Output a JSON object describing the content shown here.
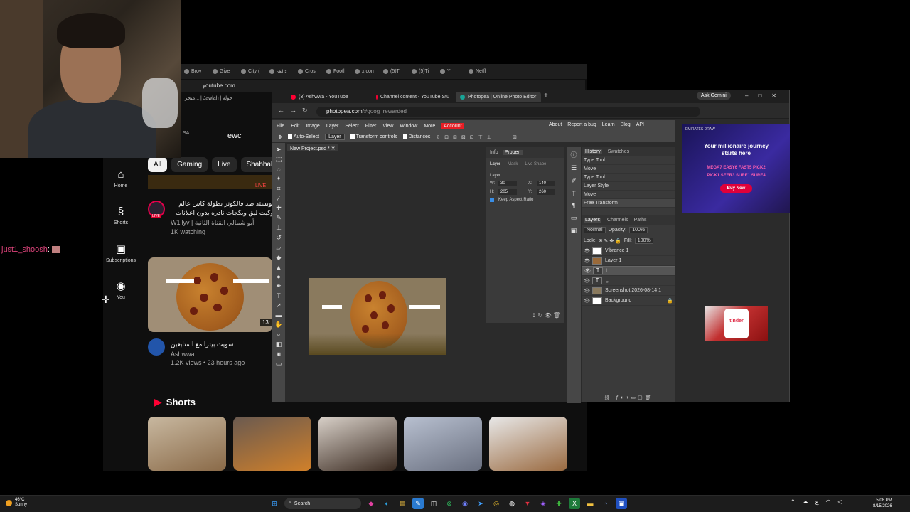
{
  "overlay": {
    "chat_user": "just1_shoosh",
    "chat_sep": ":"
  },
  "youtube": {
    "tabs": [
      "Brov",
      "Give",
      "City (",
      "شاهد",
      "Cros",
      "Footl",
      "x.con",
      "(5)Ti",
      "(5)Ti",
      "Y",
      "Netfl"
    ],
    "address": "youtube.com",
    "bookmarks": "متجر... | Jawlah | جولة",
    "search_value": "ewc",
    "sa_label": "SA",
    "nav": [
      {
        "icon": "home-icon",
        "label": "Home"
      },
      {
        "icon": "shorts-icon",
        "label": "Shorts"
      },
      {
        "icon": "subscriptions-icon",
        "label": "Subscriptions"
      },
      {
        "icon": "you-icon",
        "label": "You"
      }
    ],
    "chips": [
      "All",
      "Gaming",
      "Live",
      "Shabbal"
    ],
    "live_video": {
      "title": "تويستد ضد فالكونز بطولة كاس عالم وكيت ليق وبكجات نادره بدون اعلانات",
      "badge": "LIVE",
      "channel": "W1llyv | أبو شمالي القناة الثانية",
      "watching": "1K watching"
    },
    "video": {
      "title": "سويت بيتزا مع المتابعين",
      "duration": "13:",
      "channel": "Ashwwa",
      "meta": "1.2K views • 23 hours ago"
    },
    "shorts_title": "Shorts"
  },
  "photopea": {
    "tabs": [
      "(3) Ashwwa - YouTube",
      "Channel content - YouTube Stu",
      "Photopea | Online Photo Editor"
    ],
    "gemini": "Ask Gemini",
    "url_host": "photopea.com",
    "url_path": "/#goog_rewarded",
    "menu": [
      "File",
      "Edit",
      "Image",
      "Layer",
      "Select",
      "Filter",
      "View",
      "Window",
      "More",
      "Account"
    ],
    "menu_right": [
      "About",
      "Report a bug",
      "Learn",
      "Blog",
      "API"
    ],
    "toolopts": {
      "auto_select": "Auto-Select",
      "layer_select": "Layer",
      "transform": "Transform controls",
      "distances": "Distances"
    },
    "doc_tab": "New Project.psd *",
    "props": {
      "tabs": [
        "Info",
        "Properi"
      ],
      "sub": [
        "Layer",
        "Mask",
        "Live Shape"
      ],
      "section": "Layer",
      "w_label": "W:",
      "w": "30",
      "x_label": "X:",
      "x": "140",
      "h_label": "H:",
      "h": "205",
      "y_label": "Y:",
      "y": "260",
      "keep_aspect": "Keep Aspect Ratio"
    },
    "history": {
      "tabs": [
        "History",
        "Swatches"
      ],
      "items": [
        "Type Tool",
        "Move",
        "Type Tool",
        "Layer Style",
        "Move",
        "Free Transform"
      ]
    },
    "layers": {
      "tabs": [
        "Layers",
        "Channels",
        "Paths"
      ],
      "blend": "Normal",
      "opacity_label": "Opacity:",
      "opacity": "100%",
      "lock_label": "Lock:",
      "fill_label": "Fill:",
      "fill": "100%",
      "items": [
        {
          "name": "Vibrance 1"
        },
        {
          "name": "Layer 1"
        },
        {
          "name": "ا"
        },
        {
          "name": "ـــــــبيـ"
        },
        {
          "name": "Screenshot 2026-08-14 1"
        },
        {
          "name": "Background"
        }
      ]
    },
    "ad1": {
      "brand": "EMIRATES DRAW",
      "headline1": "Your millionaire journey",
      "headline2": "starts here",
      "games1": "MEGA7 EASY6 FAST5 PICK2",
      "games2": "PICK1 SEER3 SURE1 SURE4",
      "cta": "Buy Now"
    },
    "ad2": {
      "brand": "tinder"
    }
  },
  "taskbar": {
    "weather_temp": "46°C",
    "weather_desc": "Sunny",
    "search": "Search",
    "time": "5:08 PM",
    "date": "8/15/2026",
    "lang": "ع"
  }
}
